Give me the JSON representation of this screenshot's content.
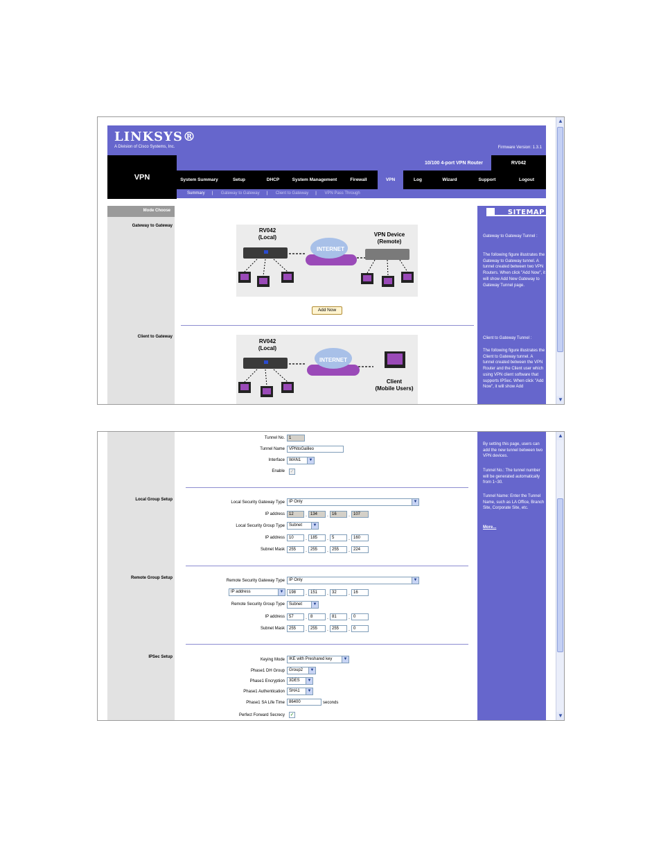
{
  "brand": {
    "name": "LINKSYS®",
    "sub": "A Division of Cisco Systems, Inc.",
    "firmware": "Firmware Version: 1.3.1"
  },
  "section_title": "VPN",
  "product": "10/100 4-port VPN Router",
  "model": "RV042",
  "tabs": [
    {
      "label": "System Summary"
    },
    {
      "label": "Setup"
    },
    {
      "label": "DHCP"
    },
    {
      "label": "System Management"
    },
    {
      "label": "Firewall"
    },
    {
      "label": "VPN"
    },
    {
      "label": "Log"
    },
    {
      "label": "Wizard"
    },
    {
      "label": "Support"
    },
    {
      "label": "Logout"
    }
  ],
  "subtabs": [
    "Summary",
    "Gateway to Gateway",
    "Client to Gateway",
    "VPN Pass Through"
  ],
  "mode_choose": "Mode Choose",
  "labels": {
    "g2g": "Gateway to Gateway",
    "c2g": "Client to Gateway"
  },
  "sitemap": "SITEMAP",
  "help1": {
    "g2g": "Gateway to Gateway Tunnel :",
    "g2g_desc": "The following figure illustrates the Gateway to Gateway tunnel. A tunnel created between two VPN Routers. When click \"Add Now\", it will show Add New Gateway to Gateway Tunnel page.",
    "c2g": "Client to Gateway Tunnel :",
    "c2g_desc": "The following figure illustrates the Client to Gateway tunnel. A tunnel created between the VPN Router and the Client user which using VPN client software that supports IPSec. When click \"Add Now\", it will show Add"
  },
  "diagram1": {
    "local": "RV042\n(Local)",
    "internet": "INTERNET",
    "remote": "VPN Device\n(Remote)"
  },
  "diagram2": {
    "local": "RV042\n(Local)",
    "internet": "INTERNET",
    "client": "Client\n(Mobile Users)"
  },
  "add_now": "Add Now",
  "form": {
    "tunnel_no_label": "Tunnel No.",
    "tunnel_no": "1",
    "tunnel_name_label": "Tunnel Name",
    "tunnel_name": "VPNtoGalileo",
    "interface_label": "Interface",
    "interface": "WAN1",
    "enable_label": "Enable",
    "local_group_setup": "Local Group Setup",
    "local_sec_gw_type_label": "Local Security Gateway Type",
    "local_sec_gw_type": "IP Only",
    "ip_address_label": "IP address",
    "local_ip": [
      "12",
      "134",
      "16",
      "107"
    ],
    "local_sec_group_type_label": "Local Security Group Type",
    "local_sec_group_type": "Subnet",
    "local_group_ip": [
      "10",
      "185",
      "5",
      "160"
    ],
    "subnet_mask_label": "Subnet Mask",
    "local_mask": [
      "255",
      "255",
      "255",
      "224"
    ],
    "remote_group_setup": "Remote Group Setup",
    "remote_sec_gw_type_label": "Remote Security Gateway Type",
    "remote_sec_gw_type": "IP Only",
    "remote_addr_type": "IP address",
    "remote_ip": [
      "198",
      "151",
      "32",
      "16"
    ],
    "remote_sec_group_type_label": "Remote Security Group Type",
    "remote_sec_group_type": "Subnet",
    "remote_group_ip": [
      "57",
      "8",
      "81",
      "0"
    ],
    "remote_mask": [
      "255",
      "255",
      "255",
      "0"
    ],
    "ipsec_setup": "IPSec Setup",
    "keying_mode_label": "Keying Mode",
    "keying_mode": "IKE with Preshared key",
    "phase1_dh_label": "Phase1 DH Group",
    "phase1_dh": "Group2",
    "phase1_enc_label": "Phase1 Encryption",
    "phase1_enc": "3DES",
    "phase1_auth_label": "Phase1 Authentication",
    "phase1_auth": "SHA1",
    "phase1_sa_label": "Phase1 SA Life Time",
    "phase1_sa": "86400",
    "seconds": "seconds",
    "pfs_label": "Perfect Forward Secrecy"
  },
  "help2": {
    "intro": "By setting this page, users can add the new tunnel between two VPN devices.",
    "tunnel_no": "Tunnel No.: The tunnel number will be generated automatically from 1~30.",
    "tunnel_name": "Tunnel Name: Enter the Tunnel Name, such as LA Office, Branch Site, Corporate Site, etc.",
    "more": "More..."
  }
}
